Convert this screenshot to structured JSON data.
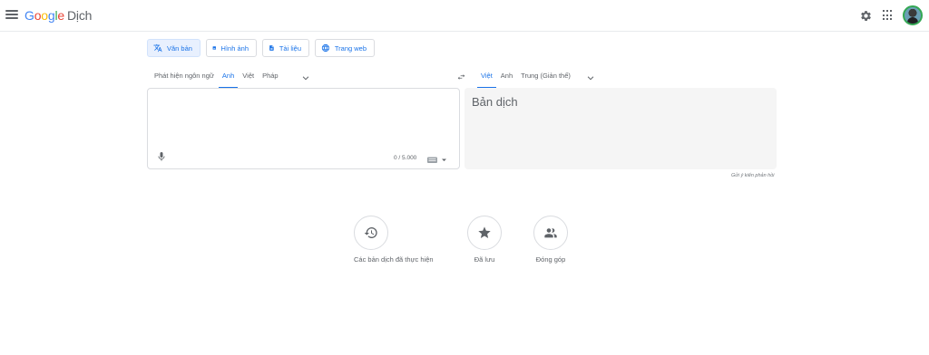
{
  "header": {
    "logo_g": "G",
    "logo_o1": "o",
    "logo_o2": "o",
    "logo_g2": "g",
    "logo_l": "l",
    "logo_e": "e",
    "product_name": "Dịch"
  },
  "mode_tabs": [
    {
      "label": "Văn bản",
      "icon": "translate-icon",
      "active": true
    },
    {
      "label": "Hình ảnh",
      "icon": "image-icon",
      "active": false
    },
    {
      "label": "Tài liệu",
      "icon": "document-icon",
      "active": false
    },
    {
      "label": "Trang web",
      "icon": "globe-icon",
      "active": false
    }
  ],
  "source_languages": [
    {
      "label": "Phát hiện ngôn ngữ",
      "active": false
    },
    {
      "label": "Anh",
      "active": true
    },
    {
      "label": "Việt",
      "active": false
    },
    {
      "label": "Pháp",
      "active": false
    }
  ],
  "target_languages": [
    {
      "label": "Việt",
      "active": true
    },
    {
      "label": "Anh",
      "active": false
    },
    {
      "label": "Trung (Giản thể)",
      "active": false
    }
  ],
  "source": {
    "value": "",
    "char_count": "0 / 5.000"
  },
  "target": {
    "placeholder": "Bản dịch"
  },
  "feedback_label": "Gửi ý kiến phản hồi",
  "bottom_actions": [
    {
      "label": "Các bản dịch đã thực hiện",
      "icon": "history-icon"
    },
    {
      "label": "Đã lưu",
      "icon": "star-icon"
    },
    {
      "label": "Đóng góp",
      "icon": "people-icon"
    }
  ],
  "colors": {
    "accent": "#1a73e8",
    "active_tab_bg": "#e8f0fe",
    "target_panel_bg": "#f5f5f5"
  }
}
